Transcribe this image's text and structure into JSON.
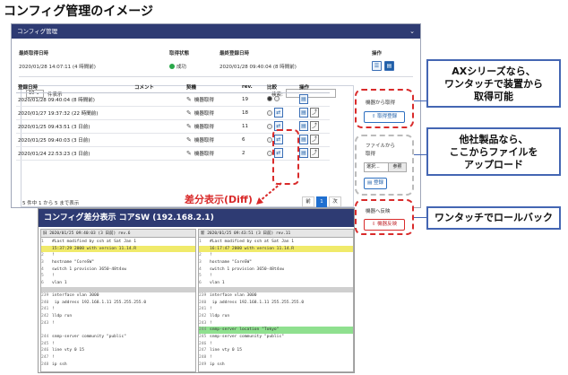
{
  "page_title": "コンフィグ管理のイメージ",
  "panel": {
    "title": "コンフィグ管理",
    "summary_headers": [
      "最終取得日時",
      "取得状態",
      "最終登録日時",
      "操作"
    ],
    "last_fetch": "2020/01/28 14:07:11 (4 時間前)",
    "status": "成功",
    "last_register": "2020/01/28 09:40:04 (8 時間前)",
    "per_page": "10",
    "per_page_suffix": "件表示",
    "search_label": "検索:",
    "table_headers": [
      "登録日時",
      "コメント",
      "契機",
      "rev.",
      "比較",
      "操作"
    ],
    "rows": [
      {
        "date": "2020/01/28 09:40:04 (8 時間前)",
        "trigger": "機器取得",
        "rev": "19"
      },
      {
        "date": "2020/01/27 19:37:32 (22 時間前)",
        "trigger": "機器取得",
        "rev": "18"
      },
      {
        "date": "2020/01/25 09:43:51 (3 日前)",
        "trigger": "機器取得",
        "rev": "11"
      },
      {
        "date": "2020/01/25 09:40:03 (3 日前)",
        "trigger": "機器取得",
        "rev": "6"
      },
      {
        "date": "2020/01/24 22:53:23 (3 日前)",
        "trigger": "機器取得",
        "rev": "2"
      }
    ],
    "footer": "5 件中 1 から 5 まで表示",
    "pager": {
      "prev": "前",
      "page": "1",
      "next": "次"
    }
  },
  "actions": {
    "fetch_label": "機器から取得",
    "fetch_button": "取得登録",
    "upload_label_1": "ファイルから",
    "upload_label_2": "取得",
    "upload_select": "選択...",
    "upload_browse": "参照",
    "upload_button": "登録",
    "rollback_label": "機器へ反映",
    "rollback_button": "機器反映"
  },
  "callouts": {
    "ax_1": "AXシリーズなら、",
    "ax_2": "ワンタッチで装置から",
    "ax_3": "取得可能",
    "other_1": "他社製品なら、",
    "other_2": "ここからファイルを",
    "other_3": "アップロード",
    "rollback": "ワンタッチでロールバック"
  },
  "diff_label": "差分表示(Diff)",
  "diff": {
    "title": "コンフィグ差分表示 コアSW (192.168.2.1)",
    "left_header": "旧 2020/01/25 09:40:03 (3 日前) rev.6",
    "right_header": "新 2020/01/25 09:43:51 (3 日前) rev.11",
    "left_lines": [
      {
        "n": "1",
        "t": "#Last modified by ssh at Sat Jan  1"
      },
      {
        "n": "",
        "t": "15:37:29 2000 with version 11.14.R",
        "hl": "y"
      },
      {
        "n": "2",
        "t": "!"
      },
      {
        "n": "3",
        "t": "hostname \"CoreSW\""
      },
      {
        "n": "4",
        "t": "switch 1 provision 3650-48t4xw"
      },
      {
        "n": "5",
        "t": "!"
      },
      {
        "n": "6",
        "t": "vlan 1"
      },
      {
        "gap": true
      },
      {
        "n": "239",
        "t": "interface vlan 3000"
      },
      {
        "n": "240",
        "t": "  ip address 192.168.1.11 255.255.255.0"
      },
      {
        "n": "241",
        "t": "!"
      },
      {
        "n": "242",
        "t": "lldp run"
      },
      {
        "n": "243",
        "t": "!"
      },
      {
        "n": "",
        "t": ""
      },
      {
        "n": "244",
        "t": "snmp-server community \"public\""
      },
      {
        "n": "245",
        "t": "!"
      },
      {
        "n": "246",
        "t": "line vty 0 15"
      },
      {
        "n": "247",
        "t": "!"
      },
      {
        "n": "248",
        "t": "ip ssh"
      }
    ],
    "right_lines": [
      {
        "n": "1",
        "t": "#Last modified by ssh at Sat Jan  1"
      },
      {
        "n": "",
        "t": "16:17:47 2000 with version 11.14.R",
        "hl": "y"
      },
      {
        "n": "2",
        "t": "!"
      },
      {
        "n": "3",
        "t": "hostname \"CoreSW\""
      },
      {
        "n": "4",
        "t": "switch 1 provision 3650-48t4xw"
      },
      {
        "n": "5",
        "t": "!"
      },
      {
        "n": "6",
        "t": "vlan 1"
      },
      {
        "gap": true
      },
      {
        "n": "239",
        "t": "interface vlan 3000"
      },
      {
        "n": "240",
        "t": "  ip address 192.168.1.11 255.255.255.0"
      },
      {
        "n": "241",
        "t": "!"
      },
      {
        "n": "242",
        "t": "lldp run"
      },
      {
        "n": "243",
        "t": "!"
      },
      {
        "n": "244",
        "t": "snmp-server location \"Tokyo\"",
        "hl": "g"
      },
      {
        "n": "245",
        "t": "snmp-server community \"public\""
      },
      {
        "n": "246",
        "t": "!"
      },
      {
        "n": "247",
        "t": "line vty 0 15"
      },
      {
        "n": "248",
        "t": "!"
      },
      {
        "n": "249",
        "t": "ip ssh"
      }
    ]
  }
}
